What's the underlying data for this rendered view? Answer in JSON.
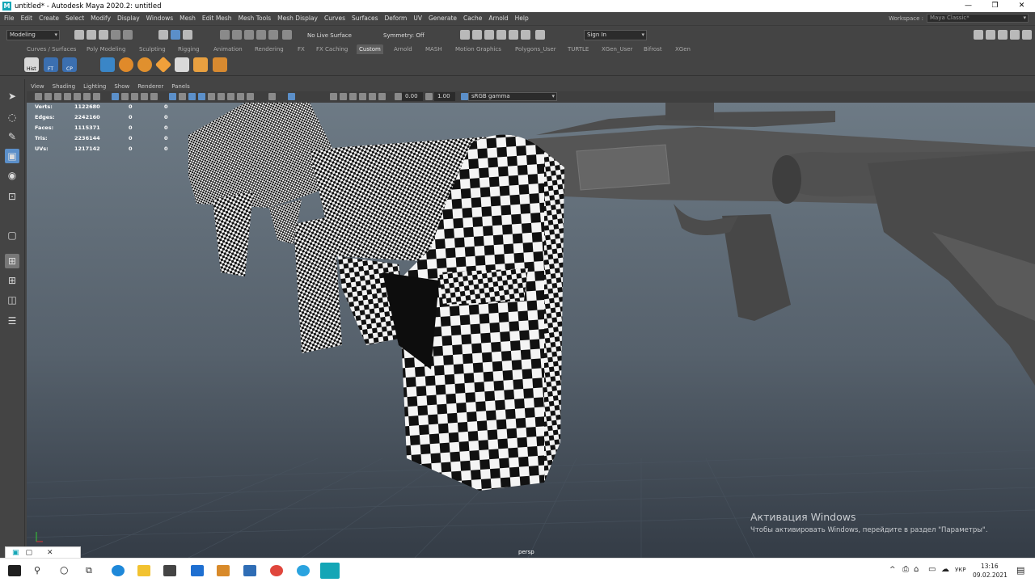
{
  "window": {
    "title": "untitled* - Autodesk Maya 2020.2: untitled",
    "app_icon": "maya-icon",
    "controls": [
      "—",
      "❐",
      "✕"
    ]
  },
  "menu": [
    "File",
    "Edit",
    "Create",
    "Select",
    "Modify",
    "Display",
    "Windows",
    "Mesh",
    "Edit Mesh",
    "Mesh Tools",
    "Mesh Display",
    "Curves",
    "Surfaces",
    "Deform",
    "UV",
    "Generate",
    "Cache",
    "Arnold",
    "Help"
  ],
  "workspace": {
    "label": "Workspace :",
    "value": "Maya Classic*"
  },
  "statusline": {
    "mode": "Modeling",
    "live_surface": "No Live Surface",
    "symmetry": "Symmetry: Off",
    "sign_in": "Sign In"
  },
  "shelf_tabs": [
    "Curves / Surfaces",
    "Poly Modeling",
    "Sculpting",
    "Rigging",
    "Animation",
    "Rendering",
    "FX",
    "FX Caching",
    "Custom",
    "Arnold",
    "MASH",
    "Motion Graphics",
    "Polygons_User",
    "TURTLE",
    "XGen_User",
    "Bifrost",
    "XGen"
  ],
  "shelf_active": "Custom",
  "shelf_labels": [
    "Hist",
    "FT",
    "CP"
  ],
  "panel_menu": [
    "View",
    "Shading",
    "Lighting",
    "Show",
    "Renderer",
    "Panels"
  ],
  "panel_toolbar": {
    "exposure": "0.00",
    "gamma": "1.00",
    "color_space": "sRGB gamma"
  },
  "hud": [
    {
      "label": "Verts:",
      "value": "1122680",
      "sel": "0",
      "comp": "0"
    },
    {
      "label": "Edges:",
      "value": "2242160",
      "sel": "0",
      "comp": "0"
    },
    {
      "label": "Faces:",
      "value": "1115371",
      "sel": "0",
      "comp": "0"
    },
    {
      "label": "Tris:",
      "value": "2236144",
      "sel": "0",
      "comp": "0"
    },
    {
      "label": "UVs:",
      "value": "1217142",
      "sel": "0",
      "comp": "0"
    }
  ],
  "camera": "persp",
  "activation": {
    "title": "Активация Windows",
    "message": "Чтобы активировать Windows, перейдите в раздел \"Параметры\"."
  },
  "taskbar": {
    "language": "УКР",
    "time": "13:16",
    "date": "09.02.2021"
  }
}
